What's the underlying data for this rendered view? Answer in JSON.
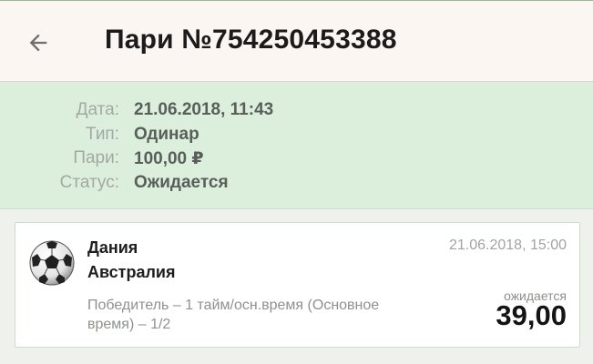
{
  "header": {
    "title": "Пари №754250453388",
    "back_icon": "arrow-left-icon"
  },
  "bet_info": {
    "rows": [
      {
        "label": "Дата:",
        "value": "21.06.2018, 11:43"
      },
      {
        "label": "Тип:",
        "value": "Одинар"
      },
      {
        "label": "Пари:",
        "value": "100,00 ₽"
      },
      {
        "label": "Статус:",
        "value": "Ожидается"
      }
    ]
  },
  "event": {
    "sport_icon": "soccer-ball-icon",
    "team_home": "Дания",
    "team_away": "Австралия",
    "date": "21.06.2018, 15:00",
    "market": "Победитель – 1 тайм/осн.время (Основное время) – 1/2",
    "status": "ожидается",
    "odds": "39,00"
  },
  "colors": {
    "header_bg": "#fbf6f1",
    "summary_bg": "#dcefdd",
    "card_border": "#c6e2c6"
  }
}
